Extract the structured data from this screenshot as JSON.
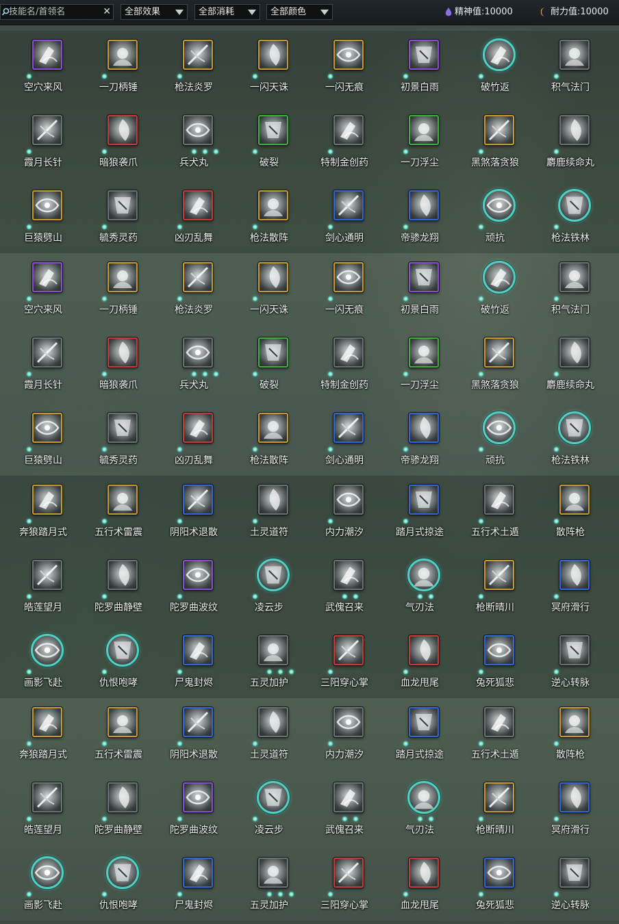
{
  "toolbar": {
    "search_placeholder": "技能名/首领名",
    "clear_symbol": "✕",
    "filters": [
      {
        "name": "effect-filter",
        "label": "全部效果"
      },
      {
        "name": "cost-filter",
        "label": "全部消耗"
      },
      {
        "name": "color-filter",
        "label": "全部颜色"
      }
    ],
    "stats": [
      {
        "name": "spirit",
        "label": "精神值:10000",
        "icon": "purple-drop-icon",
        "color": "#9b7cf0"
      },
      {
        "name": "stamina",
        "label": "耐力值:10000",
        "icon": "orange-crescent-icon",
        "color": "#e2a24a"
      }
    ]
  },
  "colors": {
    "gold": "#c89b2c",
    "purple": "#8a4dd6",
    "red": "#c8393a",
    "green": "#3fb03e",
    "blue": "#2f67d8",
    "teal": "#4fd0c1",
    "pip": "#5ed7c3"
  },
  "skill_groups": [
    [
      {
        "name": "空穴来风",
        "frame": "purple",
        "pips": 1
      },
      {
        "name": "一刀柄锤",
        "frame": "gold",
        "pips": 1
      },
      {
        "name": "枪法炎罗",
        "frame": "gold",
        "pips": 1
      },
      {
        "name": "一闪天诛",
        "frame": "gold",
        "pips": 1
      },
      {
        "name": "一闪无痕",
        "frame": "gold",
        "pips": 1
      },
      {
        "name": "初景白雨",
        "frame": "purple",
        "pips": 1
      },
      {
        "name": "破竹返",
        "frame": "teal",
        "pips": 1
      },
      {
        "name": "积气法门",
        "frame": "gray",
        "pips": 1
      },
      {
        "name": "霞月长针",
        "frame": "gray",
        "pips": 1
      },
      {
        "name": "暗狼袭爪",
        "frame": "red",
        "pips": 1
      },
      {
        "name": "兵犬丸",
        "frame": "gray",
        "pips": 3
      },
      {
        "name": "破裂",
        "frame": "green",
        "pips": 1
      },
      {
        "name": "特制金创药",
        "frame": "gray",
        "pips": 1
      },
      {
        "name": "一刀浮尘",
        "frame": "green",
        "pips": 1
      },
      {
        "name": "黑煞落贪狼",
        "frame": "gold",
        "pips": 1
      },
      {
        "name": "麝鹿续命丸",
        "frame": "gray",
        "pips": 1
      },
      {
        "name": "巨猿劈山",
        "frame": "gold",
        "pips": 1
      },
      {
        "name": "毓秀灵药",
        "frame": "gray",
        "pips": 1
      },
      {
        "name": "凶刃乱舞",
        "frame": "red",
        "pips": 1
      },
      {
        "name": "枪法散阵",
        "frame": "gold",
        "pips": 1
      },
      {
        "name": "剑心通明",
        "frame": "blue",
        "pips": 1
      },
      {
        "name": "帝骖龙翔",
        "frame": "blue",
        "pips": 1
      },
      {
        "name": "顽抗",
        "frame": "teal",
        "pips": 1
      },
      {
        "name": "枪法铁林",
        "frame": "teal",
        "pips": 1
      }
    ],
    [
      {
        "name": "空穴来风",
        "frame": "purple",
        "pips": 1
      },
      {
        "name": "一刀柄锤",
        "frame": "gold",
        "pips": 1
      },
      {
        "name": "枪法炎罗",
        "frame": "gold",
        "pips": 1
      },
      {
        "name": "一闪天诛",
        "frame": "gold",
        "pips": 1
      },
      {
        "name": "一闪无痕",
        "frame": "gold",
        "pips": 1
      },
      {
        "name": "初景白雨",
        "frame": "purple",
        "pips": 1
      },
      {
        "name": "破竹返",
        "frame": "teal",
        "pips": 1
      },
      {
        "name": "积气法门",
        "frame": "gray",
        "pips": 1
      },
      {
        "name": "霞月长针",
        "frame": "gray",
        "pips": 1
      },
      {
        "name": "暗狼袭爪",
        "frame": "red",
        "pips": 1
      },
      {
        "name": "兵犬丸",
        "frame": "gray",
        "pips": 3
      },
      {
        "name": "破裂",
        "frame": "green",
        "pips": 1
      },
      {
        "name": "特制金创药",
        "frame": "gray",
        "pips": 1
      },
      {
        "name": "一刀浮尘",
        "frame": "green",
        "pips": 1
      },
      {
        "name": "黑煞落贪狼",
        "frame": "gold",
        "pips": 1
      },
      {
        "name": "麝鹿续命丸",
        "frame": "gray",
        "pips": 1
      },
      {
        "name": "巨猿劈山",
        "frame": "gold",
        "pips": 1
      },
      {
        "name": "毓秀灵药",
        "frame": "gray",
        "pips": 1
      },
      {
        "name": "凶刃乱舞",
        "frame": "red",
        "pips": 1
      },
      {
        "name": "枪法散阵",
        "frame": "gold",
        "pips": 1
      },
      {
        "name": "剑心通明",
        "frame": "blue",
        "pips": 1
      },
      {
        "name": "帝骖龙翔",
        "frame": "blue",
        "pips": 1
      },
      {
        "name": "顽抗",
        "frame": "teal",
        "pips": 1
      },
      {
        "name": "枪法铁林",
        "frame": "teal",
        "pips": 1
      }
    ],
    [
      {
        "name": "奔狼踏月式",
        "frame": "gold",
        "pips": 1
      },
      {
        "name": "五行术雷震",
        "frame": "gold",
        "pips": 1
      },
      {
        "name": "阴阳术退散",
        "frame": "blue",
        "pips": 1
      },
      {
        "name": "土灵道符",
        "frame": "gray",
        "pips": 1
      },
      {
        "name": "内力潮汐",
        "frame": "gray",
        "pips": 1
      },
      {
        "name": "踏月式掠途",
        "frame": "blue",
        "pips": 1
      },
      {
        "name": "五行术土遁",
        "frame": "gray",
        "pips": 1
      },
      {
        "name": "散阵枪",
        "frame": "gold",
        "pips": 1
      },
      {
        "name": "皓莲望月",
        "frame": "gray",
        "pips": 1
      },
      {
        "name": "陀罗曲静壁",
        "frame": "gray",
        "pips": 1
      },
      {
        "name": "陀罗曲波纹",
        "frame": "purple",
        "pips": 1
      },
      {
        "name": "凌云步",
        "frame": "teal",
        "pips": 1
      },
      {
        "name": "武傀召来",
        "frame": "gray",
        "pips": 2
      },
      {
        "name": "气刃法",
        "frame": "teal",
        "pips": 2
      },
      {
        "name": "枪断晴川",
        "frame": "gold",
        "pips": 1
      },
      {
        "name": "冥府滑行",
        "frame": "blue",
        "pips": 1
      },
      {
        "name": "画影飞赴",
        "frame": "teal",
        "pips": 1
      },
      {
        "name": "仇恨咆哮",
        "frame": "teal",
        "pips": 1
      },
      {
        "name": "尸鬼封烬",
        "frame": "blue",
        "pips": 1
      },
      {
        "name": "五灵加护",
        "frame": "gray",
        "pips": 3
      },
      {
        "name": "三阳穿心掌",
        "frame": "red",
        "pips": 1
      },
      {
        "name": "血龙甩尾",
        "frame": "red",
        "pips": 1
      },
      {
        "name": "兔死狐悲",
        "frame": "blue",
        "pips": 1
      },
      {
        "name": "逆心转脉",
        "frame": "gray",
        "pips": 1
      }
    ],
    [
      {
        "name": "奔狼踏月式",
        "frame": "gold",
        "pips": 1
      },
      {
        "name": "五行术雷震",
        "frame": "gold",
        "pips": 1
      },
      {
        "name": "阴阳术退散",
        "frame": "blue",
        "pips": 1
      },
      {
        "name": "土灵道符",
        "frame": "gray",
        "pips": 1
      },
      {
        "name": "内力潮汐",
        "frame": "gray",
        "pips": 1
      },
      {
        "name": "踏月式掠途",
        "frame": "blue",
        "pips": 1
      },
      {
        "name": "五行术土遁",
        "frame": "gray",
        "pips": 1
      },
      {
        "name": "散阵枪",
        "frame": "gold",
        "pips": 1
      },
      {
        "name": "皓莲望月",
        "frame": "gray",
        "pips": 1
      },
      {
        "name": "陀罗曲静壁",
        "frame": "gray",
        "pips": 1
      },
      {
        "name": "陀罗曲波纹",
        "frame": "purple",
        "pips": 1
      },
      {
        "name": "凌云步",
        "frame": "teal",
        "pips": 1
      },
      {
        "name": "武傀召来",
        "frame": "gray",
        "pips": 2
      },
      {
        "name": "气刃法",
        "frame": "teal",
        "pips": 2
      },
      {
        "name": "枪断晴川",
        "frame": "gold",
        "pips": 1
      },
      {
        "name": "冥府滑行",
        "frame": "blue",
        "pips": 1
      },
      {
        "name": "画影飞赴",
        "frame": "teal",
        "pips": 1
      },
      {
        "name": "仇恨咆哮",
        "frame": "teal",
        "pips": 1
      },
      {
        "name": "尸鬼封烬",
        "frame": "blue",
        "pips": 1
      },
      {
        "name": "五灵加护",
        "frame": "gray",
        "pips": 3
      },
      {
        "name": "三阳穿心掌",
        "frame": "red",
        "pips": 1
      },
      {
        "name": "血龙甩尾",
        "frame": "red",
        "pips": 1
      },
      {
        "name": "兔死狐悲",
        "frame": "blue",
        "pips": 1
      },
      {
        "name": "逆心转脉",
        "frame": "gray",
        "pips": 1
      }
    ]
  ]
}
